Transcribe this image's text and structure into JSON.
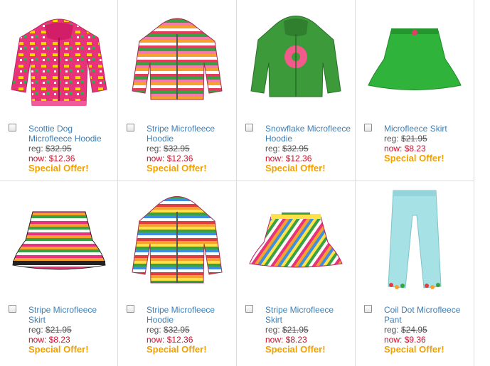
{
  "products": [
    {
      "name": "Scottie Dog Microfleece Hoodie",
      "reg_label": "reg:",
      "reg_price": "$32.95",
      "now_label": "now:",
      "now_price": "$12.36",
      "offer": "Special Offer!",
      "icon": "pink-dog-print-hoodie"
    },
    {
      "name": "Stripe Microfleece Hoodie",
      "reg_label": "reg:",
      "reg_price": "$32.95",
      "now_label": "now:",
      "now_price": "$12.36",
      "offer": "Special Offer!",
      "icon": "striped-hoodie"
    },
    {
      "name": "Snowflake Microfleece Hoodie",
      "reg_label": "reg:",
      "reg_price": "$32.95",
      "now_label": "now:",
      "now_price": "$12.36",
      "offer": "Special Offer!",
      "icon": "green-snowflake-hoodie"
    },
    {
      "name": "Microfleece Skirt",
      "reg_label": "reg:",
      "reg_price": "$21.95",
      "now_label": "now:",
      "now_price": "$8.23",
      "offer": "Special Offer!",
      "icon": "green-skirt"
    },
    {
      "name": "Stripe Microfleece Skirt",
      "reg_label": "reg:",
      "reg_price": "$21.95",
      "now_label": "now:",
      "now_price": "$8.23",
      "offer": "Special Offer!",
      "icon": "striped-skirt"
    },
    {
      "name": "Stripe Microfleece Hoodie",
      "reg_label": "reg:",
      "reg_price": "$32.95",
      "now_label": "now:",
      "now_price": "$12.36",
      "offer": "Special Offer!",
      "icon": "rainbow-striped-hoodie"
    },
    {
      "name": "Stripe Microfleece Skirt",
      "reg_label": "reg:",
      "reg_price": "$21.95",
      "now_label": "now:",
      "now_price": "$8.23",
      "offer": "Special Offer!",
      "icon": "diagonal-striped-skirt"
    },
    {
      "name": "Coil Dot Microfleece Pant",
      "reg_label": "reg:",
      "reg_price": "$24.95",
      "now_label": "now:",
      "now_price": "$9.36",
      "offer": "Special Offer!",
      "icon": "light-blue-pants"
    }
  ],
  "colors": {
    "link": "#3d7fb7",
    "now_price": "#c8102e",
    "offer": "#f2a100",
    "border": "#dcdcdc"
  }
}
